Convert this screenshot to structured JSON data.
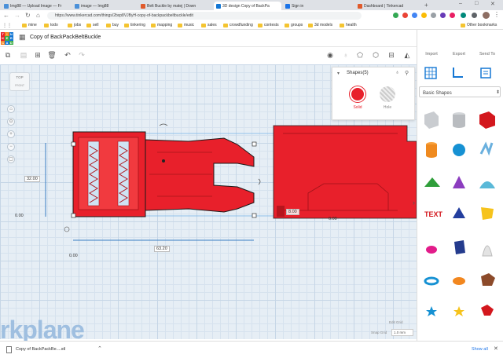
{
  "browser": {
    "tabs": [
      {
        "title": "Img88 — Upload Image — Fr",
        "color": "#4a90d9"
      },
      {
        "title": "image — Img88",
        "color": "#4a90d9"
      },
      {
        "title": "Belt Buckle by matej | Down",
        "color": "#e05a2b"
      },
      {
        "title": "3D design Copy of BackPa",
        "color": "#1477d4"
      },
      {
        "title": "Sign in",
        "color": "#1a73e8"
      },
      {
        "title": "Dashboard | Tinkercad",
        "color": "#e05a2b"
      }
    ],
    "url": "https://www.tinkercad.com/things/2bxp8VJByH-copy-of-backpackbeltbuckle/edit",
    "bookmarks": [
      "mine",
      "todo",
      "jobs",
      "sell",
      "buy",
      "tinkering",
      "mapping",
      "music",
      "sales",
      "crowdfunding",
      "contests",
      "groups",
      "3d models",
      "health"
    ],
    "other_bookmarks": "Other bookmarks"
  },
  "app": {
    "design_title": "Copy of BackPackBeltBuckle",
    "logo_letters": [
      "TIN",
      "KER",
      "CAD"
    ],
    "right_tabs": {
      "import": "Import",
      "export": "Export",
      "send_to": "Send To"
    },
    "shapes_panel_title": "Shapes(5)",
    "solid_label": "Solid",
    "hole_label": "Hole",
    "basic_shapes_label": "Basic Shapes",
    "viewcube_top": "TOP",
    "viewcube_front": "FRONT",
    "watermark": "rkplane",
    "edit_grid": "Edit Grid",
    "snap_grid_label": "Snap Grid",
    "snap_grid_value": "1.0 mm",
    "dimensions": {
      "height": "32.00",
      "width": "63.20",
      "x0": "0.00",
      "y0": "0.00",
      "x_offset": "0.00",
      "z": "8.00"
    }
  },
  "download": {
    "file": "Copy of BackPackBe....stl",
    "show_all": "Show all"
  },
  "colors": {
    "accent": "#1477d4",
    "shape_red": "#e8202b",
    "workplane": "#e6eef5"
  }
}
